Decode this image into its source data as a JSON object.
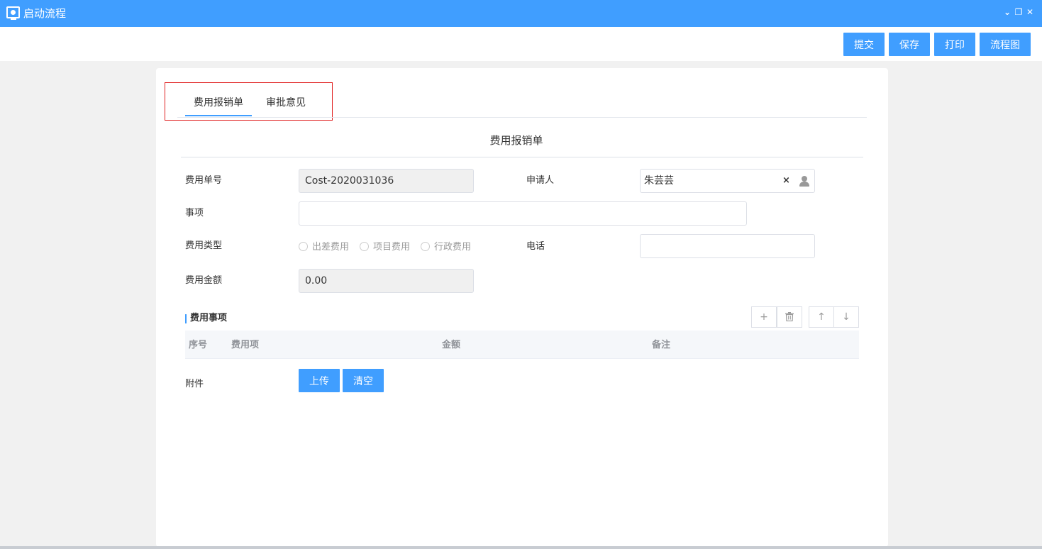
{
  "window": {
    "title": "启动流程",
    "collapse_glyph": "⌄",
    "restore_glyph": "❐",
    "close_glyph": "✕"
  },
  "toolbar": {
    "submit": "提交",
    "save": "保存",
    "print": "打印",
    "flowchart": "流程图"
  },
  "tabs": [
    {
      "label": "费用报销单",
      "active": true
    },
    {
      "label": "审批意见",
      "active": false
    }
  ],
  "form": {
    "title": "费用报销单",
    "cost_no": {
      "label": "费用单号",
      "value": "Cost-2020031036"
    },
    "applicant": {
      "label": "申请人",
      "value": "朱芸芸",
      "clear_glyph": "×"
    },
    "item": {
      "label": "事项",
      "value": ""
    },
    "cost_type": {
      "label": "费用类型",
      "options": [
        "出差费用",
        "项目费用",
        "行政费用"
      ]
    },
    "phone": {
      "label": "电话",
      "value": ""
    },
    "amount": {
      "label": "费用金额",
      "value": "0.00"
    }
  },
  "detail": {
    "title": "费用事项",
    "buttons": {
      "add": "+",
      "delete_icon": "trash-icon",
      "up": "↑",
      "down": "↓"
    },
    "columns": [
      "序号",
      "费用项",
      "金额",
      "备注"
    ]
  },
  "attachment": {
    "label": "附件",
    "upload": "上传",
    "clear": "清空"
  },
  "colors": {
    "accent": "#409eff",
    "highlight_border": "#e02020"
  }
}
